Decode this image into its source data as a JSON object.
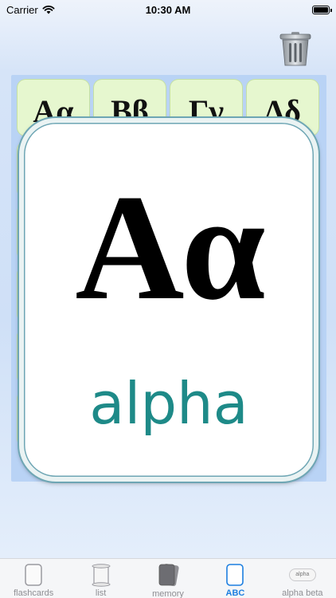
{
  "status_bar": {
    "carrier": "Carrier",
    "time": "10:30 AM"
  },
  "toolbar": {
    "trash_icon": "trash-can-icon"
  },
  "tiles": [
    {
      "letters": "Αα"
    },
    {
      "letters": "Ββ"
    },
    {
      "letters": "Γγ"
    },
    {
      "letters": "Δδ"
    }
  ],
  "card": {
    "letters": "Αα",
    "name": "alpha"
  },
  "tab_bar": {
    "items": [
      {
        "label": "flashcards",
        "icon": "flashcard-outline-icon"
      },
      {
        "label": "list",
        "icon": "scroll-icon"
      },
      {
        "label": "memory",
        "icon": "card-stack-icon"
      },
      {
        "label": "ABC",
        "icon": "card-outline-icon",
        "active": true
      },
      {
        "label": "alpha beta",
        "icon": "alpha-pill-icon",
        "pill_text": "alpha"
      }
    ]
  },
  "colors": {
    "card_name": "#1e8a88",
    "active_tab": "#1d7fe0",
    "tile": "#e6f7cf",
    "board": "#b9d3f5"
  }
}
